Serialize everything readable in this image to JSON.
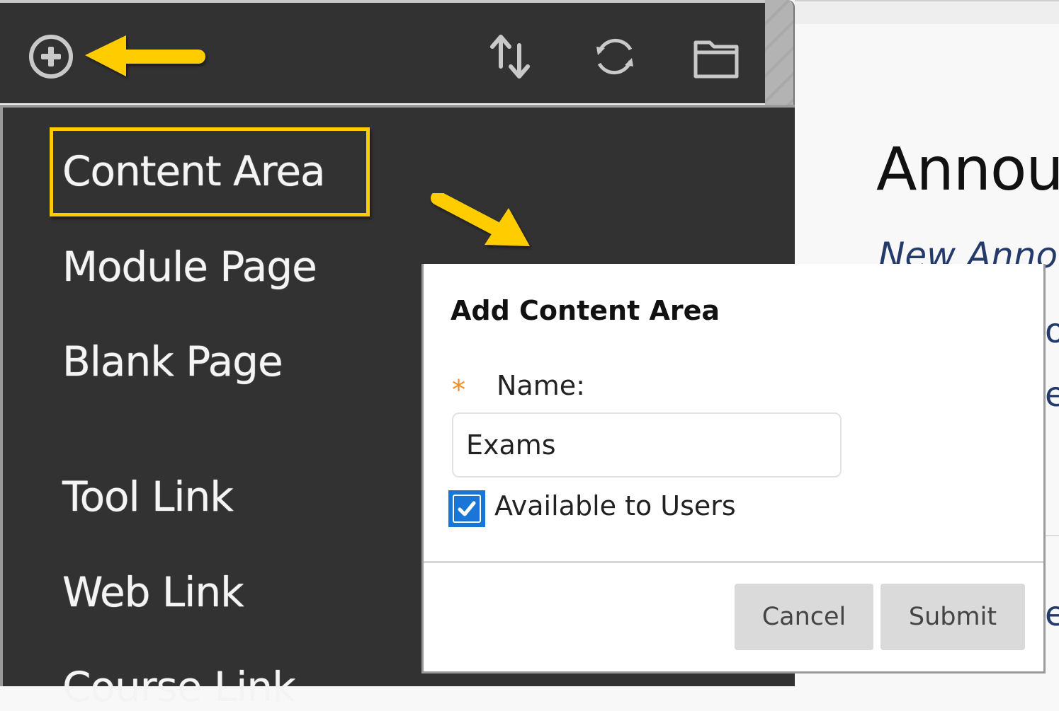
{
  "toolbar": {
    "icons": [
      {
        "name": "add-menu-item-icon",
        "glyph": "circle-plus"
      },
      {
        "name": "reorder-icon",
        "glyph": "up-down-arrows"
      },
      {
        "name": "refresh-icon",
        "glyph": "circular-arrows"
      },
      {
        "name": "folder-icon",
        "glyph": "folder"
      }
    ]
  },
  "menu": {
    "items": [
      {
        "label": "Content Area",
        "highlighted": true
      },
      {
        "label": "Module Page"
      },
      {
        "label": "Blank Page"
      },
      {
        "label": "Tool Link"
      },
      {
        "label": "Web Link"
      },
      {
        "label": "Course Link"
      }
    ]
  },
  "annotations": {
    "color": "#ffcc00"
  },
  "background_page": {
    "heading": "Announcements",
    "subheading": "New Announcement",
    "fragments": [
      "o",
      "e",
      "e"
    ]
  },
  "dialog": {
    "title": "Add Content Area",
    "required_mark": "*",
    "name_label": "Name:",
    "name_value": "Exams",
    "available_checked": true,
    "available_label": "Available to Users",
    "cancel_label": "Cancel",
    "submit_label": "Submit"
  },
  "colors": {
    "menu_bg": "#323232",
    "highlight": "#ffcc00",
    "checkbox": "#1a76d6",
    "required": "#f28a1e",
    "button_bg": "#dadada"
  }
}
